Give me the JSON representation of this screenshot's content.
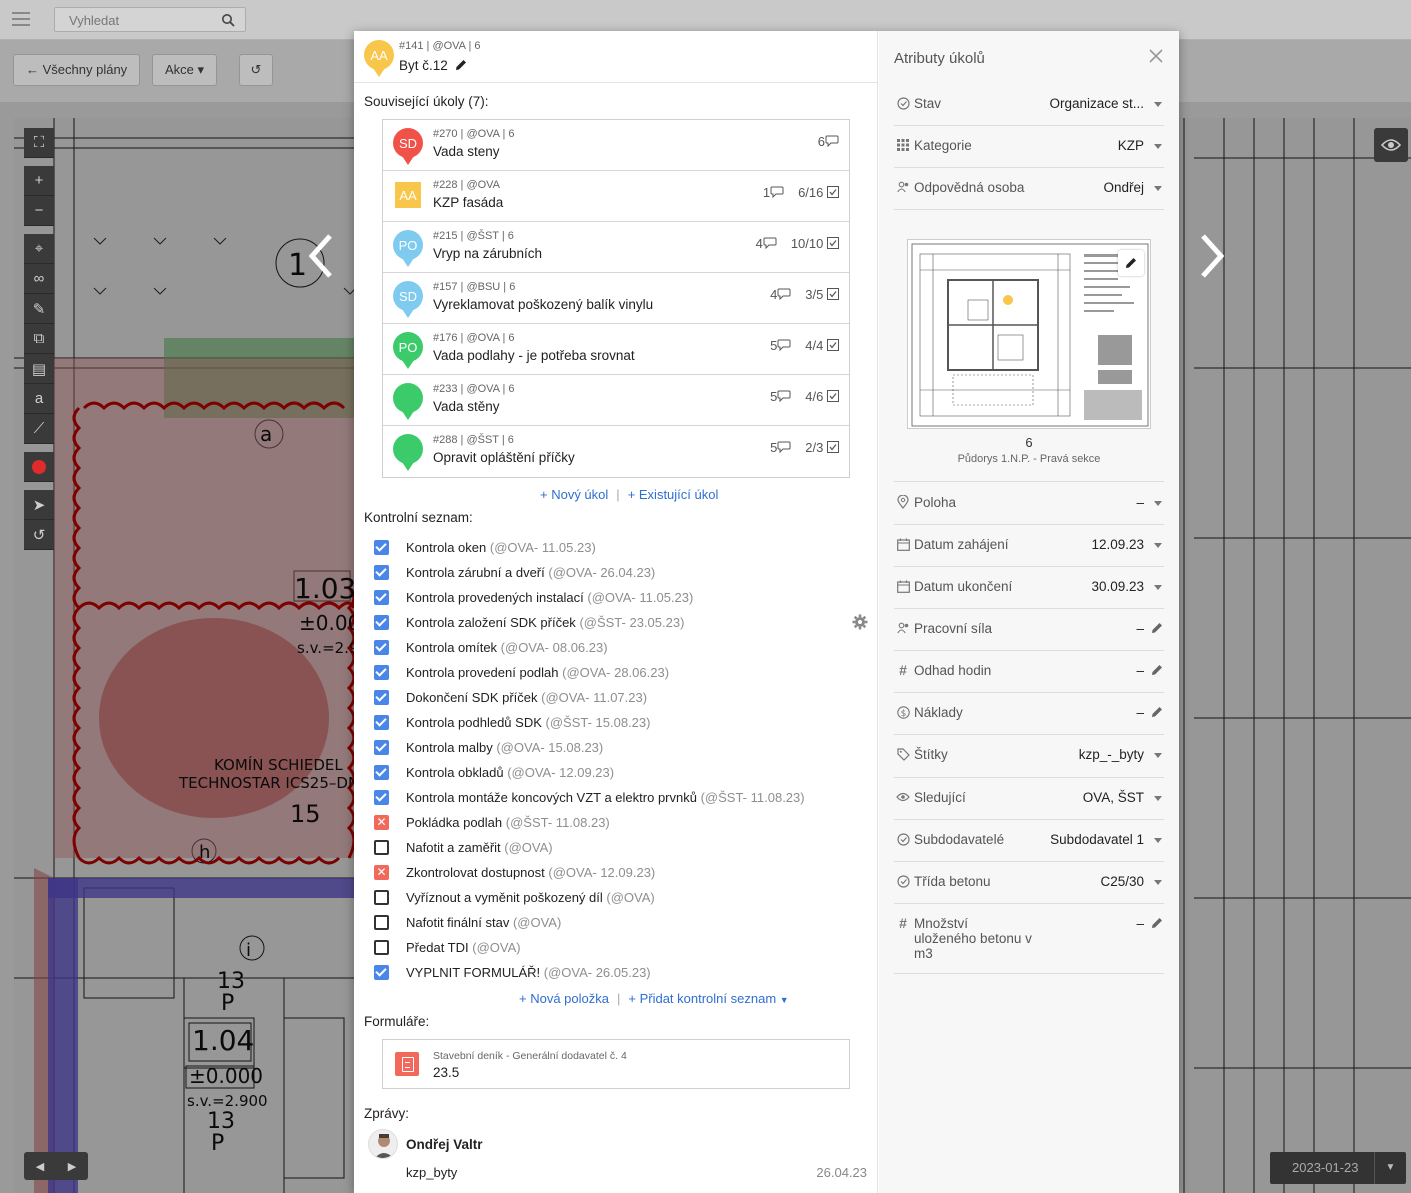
{
  "app": {
    "search_placeholder": "Vyhledat",
    "back_button": "Všechny plány",
    "actions_button": "Akce",
    "date": "2023-01-23"
  },
  "colors": {
    "accent_blue": "#4a86e8",
    "link_blue": "#2f6fd1",
    "red": "#f0695a",
    "yellow": "#f7c64a",
    "light_blue": "#7ecbef",
    "green": "#3ccb6a"
  },
  "task": {
    "meta": "#141 | @OVA | 6",
    "title": "Byt č.12",
    "avatar": "AA"
  },
  "related": {
    "label": "Související úkoly (7):",
    "items": [
      {
        "badge": "SD",
        "color": "#f0524a",
        "meta": "#270 | @OVA | 6",
        "title": "Vada steny",
        "comments": "6",
        "checks": ""
      },
      {
        "badge": "AA",
        "color": "#f7c64a",
        "meta": "#228 | @OVA",
        "title": "KZP fasáda",
        "comments": "1",
        "checks": "6/16"
      },
      {
        "badge": "PO",
        "color": "#7ecbef",
        "meta": "#215 | @ŠST | 6",
        "title": "Vryp na zárubních",
        "comments": "4",
        "checks": "10/10"
      },
      {
        "badge": "SD",
        "color": "#7ecbef",
        "meta": "#157 | @BSU | 6",
        "title": "Vyreklamovat poškozený balík vinylu",
        "comments": "4",
        "checks": "3/5"
      },
      {
        "badge": "PO",
        "color": "#3ccb6a",
        "meta": "#176 | @OVA | 6",
        "title": "Vada podlahy - je potřeba srovnat",
        "comments": "5",
        "checks": "4/4"
      },
      {
        "badge": "",
        "color": "#3ccb6a",
        "meta": "#233 | @OVA | 6",
        "title": "Vada stěny",
        "comments": "5",
        "checks": "4/6"
      },
      {
        "badge": "",
        "color": "#3ccb6a",
        "meta": "#288 | @ŠST | 6",
        "title": "Opravit opláštění příčky",
        "comments": "5",
        "checks": "2/3"
      }
    ],
    "new_link": "+ Nový úkol",
    "existing_link": "+ Existující úkol"
  },
  "checklist": {
    "label": "Kontrolní seznam:",
    "items": [
      {
        "state": "on",
        "text": "Kontrola oken",
        "who": "(@OVA- 11.05.23)"
      },
      {
        "state": "on",
        "text": "Kontrola zárubní a dveří",
        "who": "(@OVA- 26.04.23)"
      },
      {
        "state": "on",
        "text": "Kontrola provedených instalací",
        "who": "(@OVA- 11.05.23)"
      },
      {
        "state": "on",
        "text": "Kontrola založení SDK příček",
        "who": "(@ŠST- 23.05.23)"
      },
      {
        "state": "on",
        "text": "Kontrola omítek",
        "who": "(@OVA- 08.06.23)"
      },
      {
        "state": "on",
        "text": "Kontrola provedení podlah",
        "who": "(@OVA- 28.06.23)"
      },
      {
        "state": "on",
        "text": "Dokončení SDK příček",
        "who": "(@OVA- 11.07.23)"
      },
      {
        "state": "on",
        "text": "Kontrola podhledů SDK",
        "who": "(@ŠST- 15.08.23)"
      },
      {
        "state": "on",
        "text": "Kontrola malby",
        "who": "(@OVA- 15.08.23)"
      },
      {
        "state": "on",
        "text": "Kontrola obkladů",
        "who": "(@OVA- 12.09.23)"
      },
      {
        "state": "on",
        "text": "Kontrola montáže koncových VZT a elektro prvnků",
        "who": "(@ŠST- 11.08.23)"
      },
      {
        "state": "x",
        "text": "Pokládka podlah",
        "who": "(@ŠST- 11.08.23)"
      },
      {
        "state": "off",
        "text": "Nafotit a zaměřit",
        "who": "(@OVA)"
      },
      {
        "state": "x",
        "text": "Zkontrolovat dostupnost",
        "who": "(@OVA- 12.09.23)"
      },
      {
        "state": "off",
        "text": "Vyříznout a vyměnit poškozený díl",
        "who": "(@OVA)"
      },
      {
        "state": "off",
        "text": "Nafotit finální stav",
        "who": "(@OVA)"
      },
      {
        "state": "off",
        "text": "Předat TDI",
        "who": "(@OVA)"
      },
      {
        "state": "on",
        "text": "VYPLNIT FORMULÁŘ!",
        "who": "(@OVA- 26.05.23)"
      }
    ],
    "new_item_link": "+ Nová položka",
    "add_list_link": "+ Přidat kontrolní seznam"
  },
  "forms": {
    "label": "Formuláře:",
    "item_meta": "Stavební deník - Generální dodavatel č. 4",
    "item_title": "23.5"
  },
  "messages": {
    "label": "Zprávy:",
    "author": "Ondřej Valtr",
    "text": "kzp_byty",
    "date": "26.04.23"
  },
  "attributes": {
    "title": "Atributy úkolů",
    "rows": [
      {
        "icon": "status-icon",
        "name": "Stav",
        "value": "Organizace st...",
        "control": "caret"
      },
      {
        "icon": "grid-icon",
        "name": "Kategorie",
        "value": "KZP",
        "control": "caret"
      },
      {
        "icon": "people-icon",
        "name": "Odpovědná osoba",
        "value": "Ondřej",
        "control": "caret"
      }
    ],
    "plan_number": "6",
    "plan_caption": "Půdorys 1.N.P. - Pravá sekce",
    "rows2": [
      {
        "icon": "location-icon",
        "name": "Poloha",
        "value": "–",
        "control": "caret"
      },
      {
        "icon": "calendar-icon",
        "name": "Datum zahájení",
        "value": "12.09.23",
        "control": "caret"
      },
      {
        "icon": "calendar-icon",
        "name": "Datum ukončení",
        "value": "30.09.23",
        "control": "caret"
      },
      {
        "icon": "people-icon",
        "name": "Pracovní síla",
        "value": "–",
        "control": "pen"
      },
      {
        "icon": "hash-icon",
        "name": "Odhad hodin",
        "value": "–",
        "control": "pen"
      },
      {
        "icon": "dollar-icon",
        "name": "Náklady",
        "value": "–",
        "control": "pen"
      },
      {
        "icon": "tag-icon",
        "name": "Štítky",
        "value": "kzp_-_byty",
        "control": "caret"
      },
      {
        "icon": "eye-icon",
        "name": "Sledující",
        "value": "OVA, ŠST",
        "control": "caret"
      },
      {
        "icon": "status-icon",
        "name": "Subdodavatelé",
        "value": "Subdodavatel 1",
        "control": "caret"
      },
      {
        "icon": "status-icon",
        "name": "Třída betonu",
        "value": "C25/30",
        "control": "caret"
      },
      {
        "icon": "hash-icon",
        "name": "Množství uloženého betonu v m3",
        "value": "–",
        "control": "pen"
      }
    ]
  }
}
